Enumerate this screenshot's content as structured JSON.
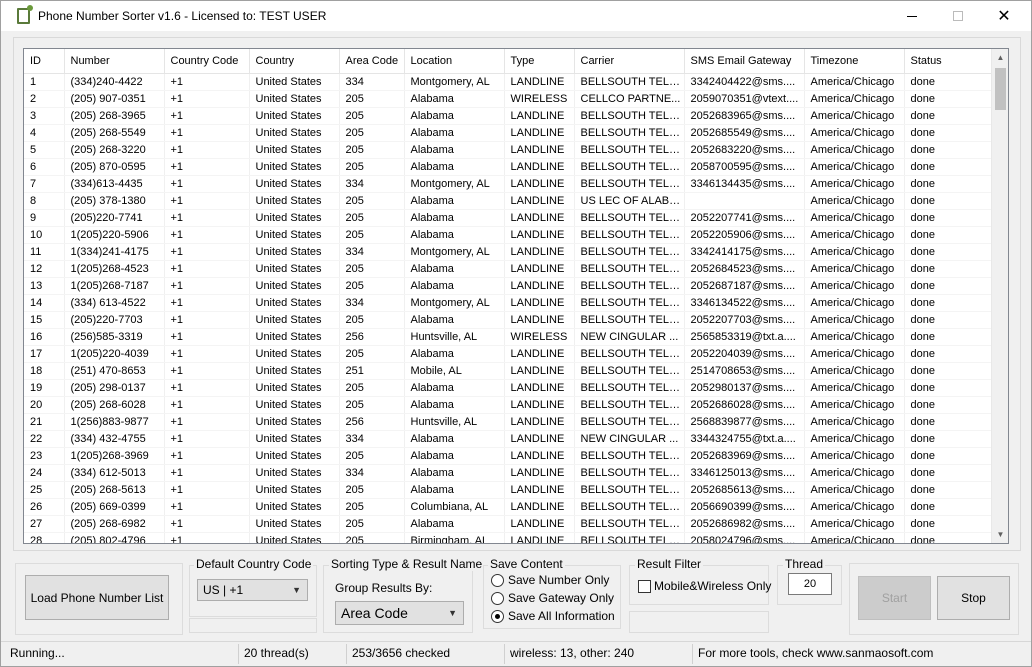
{
  "window": {
    "title": "Phone Number Sorter v1.6 - Licensed to: TEST USER"
  },
  "columns": [
    "ID",
    "Number",
    "Country Code",
    "Country",
    "Area Code",
    "Location",
    "Type",
    "Carrier",
    "SMS Email Gateway",
    "Timezone",
    "Status"
  ],
  "rows": [
    [
      "1",
      "(334)240-4422",
      "+1",
      "United States",
      "334",
      "Montgomery, AL",
      "LANDLINE",
      "BELLSOUTH TELE...",
      "3342404422@sms....",
      "America/Chicago",
      "done"
    ],
    [
      "2",
      "(205) 907-0351",
      "+1",
      "United States",
      "205",
      "Alabama",
      "WIRELESS",
      "CELLCO PARTNE...",
      "2059070351@vtext....",
      "America/Chicago",
      "done"
    ],
    [
      "3",
      "(205) 268-3965",
      "+1",
      "United States",
      "205",
      "Alabama",
      "LANDLINE",
      "BELLSOUTH TELE...",
      "2052683965@sms....",
      "America/Chicago",
      "done"
    ],
    [
      "4",
      "(205) 268-5549",
      "+1",
      "United States",
      "205",
      "Alabama",
      "LANDLINE",
      "BELLSOUTH TELE...",
      "2052685549@sms....",
      "America/Chicago",
      "done"
    ],
    [
      "5",
      "(205) 268-3220",
      "+1",
      "United States",
      "205",
      "Alabama",
      "LANDLINE",
      "BELLSOUTH TELE...",
      "2052683220@sms....",
      "America/Chicago",
      "done"
    ],
    [
      "6",
      "(205) 870-0595",
      "+1",
      "United States",
      "205",
      "Alabama",
      "LANDLINE",
      "BELLSOUTH TELE...",
      "2058700595@sms....",
      "America/Chicago",
      "done"
    ],
    [
      "7",
      "(334)613-4435",
      "+1",
      "United States",
      "334",
      "Montgomery, AL",
      "LANDLINE",
      "BELLSOUTH TELE...",
      "3346134435@sms....",
      "America/Chicago",
      "done"
    ],
    [
      "8",
      "(205) 378-1380",
      "+1",
      "United States",
      "205",
      "Alabama",
      "LANDLINE",
      "US LEC OF ALABA...",
      "",
      "America/Chicago",
      "done"
    ],
    [
      "9",
      "(205)220-7741",
      "+1",
      "United States",
      "205",
      "Alabama",
      "LANDLINE",
      "BELLSOUTH TELE...",
      "2052207741@sms....",
      "America/Chicago",
      "done"
    ],
    [
      "10",
      "1(205)220-5906",
      "+1",
      "United States",
      "205",
      "Alabama",
      "LANDLINE",
      "BELLSOUTH TELE...",
      "2052205906@sms....",
      "America/Chicago",
      "done"
    ],
    [
      "11",
      "1(334)241-4175",
      "+1",
      "United States",
      "334",
      "Montgomery, AL",
      "LANDLINE",
      "BELLSOUTH TELE...",
      "3342414175@sms....",
      "America/Chicago",
      "done"
    ],
    [
      "12",
      "1(205)268-4523",
      "+1",
      "United States",
      "205",
      "Alabama",
      "LANDLINE",
      "BELLSOUTH TELE...",
      "2052684523@sms....",
      "America/Chicago",
      "done"
    ],
    [
      "13",
      "1(205)268-7187",
      "+1",
      "United States",
      "205",
      "Alabama",
      "LANDLINE",
      "BELLSOUTH TELE...",
      "2052687187@sms....",
      "America/Chicago",
      "done"
    ],
    [
      "14",
      "(334) 613-4522",
      "+1",
      "United States",
      "334",
      "Montgomery, AL",
      "LANDLINE",
      "BELLSOUTH TELE...",
      "3346134522@sms....",
      "America/Chicago",
      "done"
    ],
    [
      "15",
      "(205)220-7703",
      "+1",
      "United States",
      "205",
      "Alabama",
      "LANDLINE",
      "BELLSOUTH TELE...",
      "2052207703@sms....",
      "America/Chicago",
      "done"
    ],
    [
      "16",
      "(256)585-3319",
      "+1",
      "United States",
      "256",
      "Huntsville, AL",
      "WIRELESS",
      "NEW CINGULAR ...",
      "2565853319@txt.a....",
      "America/Chicago",
      "done"
    ],
    [
      "17",
      "1(205)220-4039",
      "+1",
      "United States",
      "205",
      "Alabama",
      "LANDLINE",
      "BELLSOUTH TELE...",
      "2052204039@sms....",
      "America/Chicago",
      "done"
    ],
    [
      "18",
      "(251) 470-8653",
      "+1",
      "United States",
      "251",
      "Mobile, AL",
      "LANDLINE",
      "BELLSOUTH TELE...",
      "2514708653@sms....",
      "America/Chicago",
      "done"
    ],
    [
      "19",
      "(205) 298-0137",
      "+1",
      "United States",
      "205",
      "Alabama",
      "LANDLINE",
      "BELLSOUTH TELE...",
      "2052980137@sms....",
      "America/Chicago",
      "done"
    ],
    [
      "20",
      "(205) 268-6028",
      "+1",
      "United States",
      "205",
      "Alabama",
      "LANDLINE",
      "BELLSOUTH TELE...",
      "2052686028@sms....",
      "America/Chicago",
      "done"
    ],
    [
      "21",
      "1(256)883-9877",
      "+1",
      "United States",
      "256",
      "Huntsville, AL",
      "LANDLINE",
      "BELLSOUTH TELE...",
      "2568839877@sms....",
      "America/Chicago",
      "done"
    ],
    [
      "22",
      "(334) 432-4755",
      "+1",
      "United States",
      "334",
      "Alabama",
      "LANDLINE",
      "NEW CINGULAR ...",
      "3344324755@txt.a....",
      "America/Chicago",
      "done"
    ],
    [
      "23",
      "1(205)268-3969",
      "+1",
      "United States",
      "205",
      "Alabama",
      "LANDLINE",
      "BELLSOUTH TELE...",
      "2052683969@sms....",
      "America/Chicago",
      "done"
    ],
    [
      "24",
      "(334) 612-5013",
      "+1",
      "United States",
      "334",
      "Alabama",
      "LANDLINE",
      "BELLSOUTH TELE...",
      "3346125013@sms....",
      "America/Chicago",
      "done"
    ],
    [
      "25",
      "(205) 268-5613",
      "+1",
      "United States",
      "205",
      "Alabama",
      "LANDLINE",
      "BELLSOUTH TELE...",
      "2052685613@sms....",
      "America/Chicago",
      "done"
    ],
    [
      "26",
      "(205) 669-0399",
      "+1",
      "United States",
      "205",
      "Columbiana, AL",
      "LANDLINE",
      "BELLSOUTH TELE...",
      "2056690399@sms....",
      "America/Chicago",
      "done"
    ],
    [
      "27",
      "(205) 268-6982",
      "+1",
      "United States",
      "205",
      "Alabama",
      "LANDLINE",
      "BELLSOUTH TELE...",
      "2052686982@sms....",
      "America/Chicago",
      "done"
    ],
    [
      "28",
      "(205) 802-4796",
      "+1",
      "United States",
      "205",
      "Birmingham, AL",
      "LANDLINE",
      "BELLSOUTH TELE...",
      "2058024796@sms....",
      "America/Chicago",
      "done"
    ]
  ],
  "controls": {
    "load_button": "Load Phone Number List",
    "country_code_legend": "Default Country Code",
    "country_code_value": "US  |  +1",
    "sorting_legend": "Sorting Type & Result Name",
    "group_label": "Group Results By:",
    "group_value": "Area Code",
    "save_legend": "Save Content",
    "save_number_only": "Save Number Only",
    "save_gateway_only": "Save Gateway Only",
    "save_all": "Save All Information",
    "filter_legend": "Result Filter",
    "filter_mobile": "Mobile&Wireless Only",
    "thread_legend": "Thread",
    "thread_value": "20",
    "start_button": "Start",
    "stop_button": "Stop"
  },
  "status": {
    "state": "Running...",
    "threads": "20 thread(s)",
    "checked": "253/3656 checked",
    "counts": "wireless: 13, other: 240",
    "promo": "For more tools, check www.sanmaosoft.com"
  }
}
